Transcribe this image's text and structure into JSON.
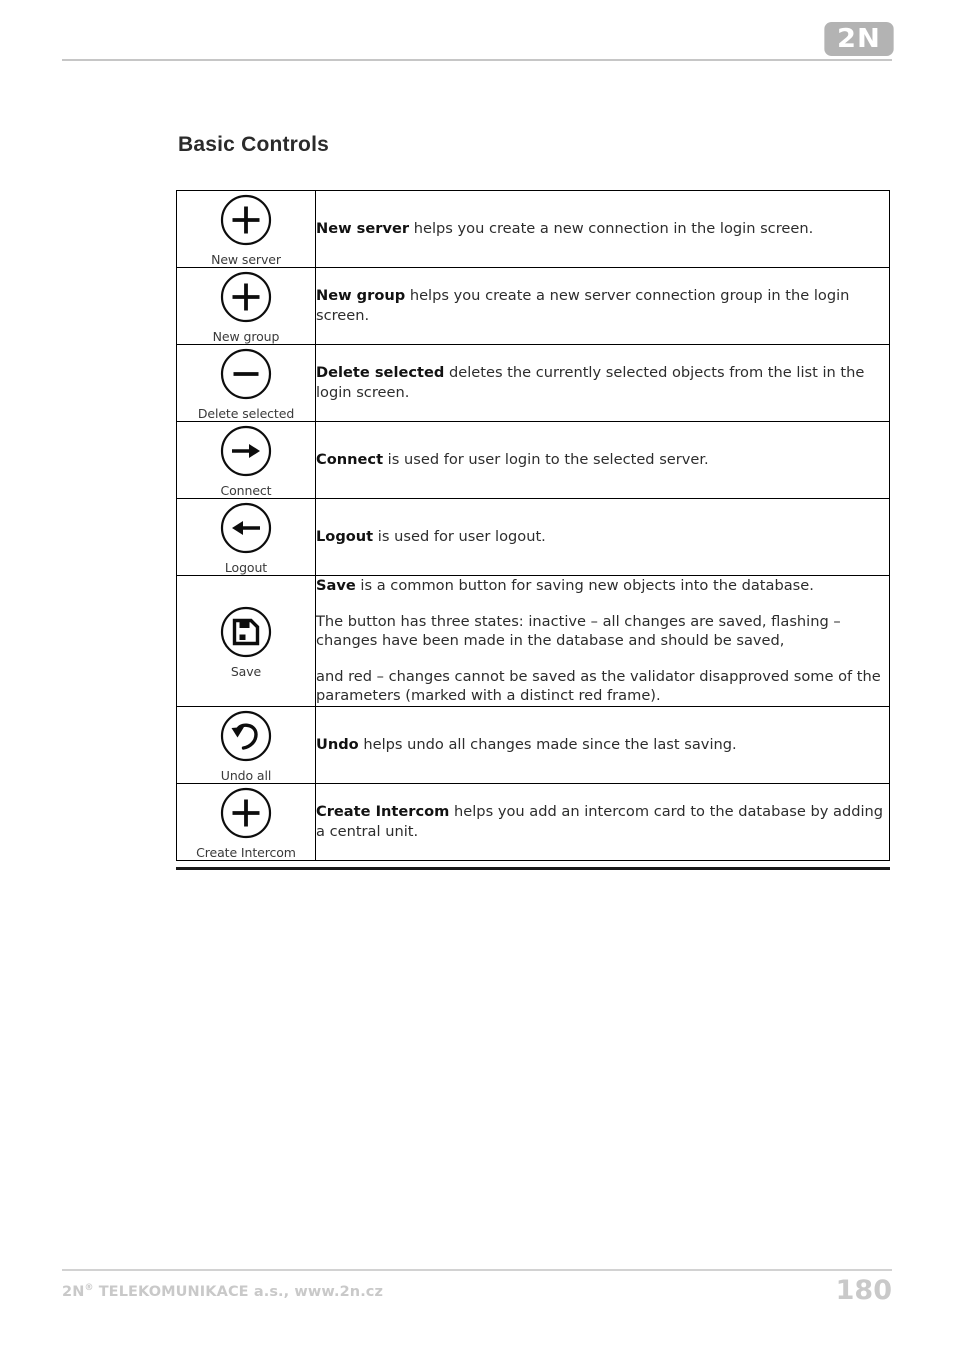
{
  "header": {
    "logo_text": "2N"
  },
  "section": {
    "title": "Basic Controls"
  },
  "table": {
    "rows": [
      {
        "icon": "plus-circle-icon",
        "icon_label": "New server",
        "paragraphs": [
          {
            "bold": "New server",
            "rest": " helps you create a new connection in the login screen."
          }
        ]
      },
      {
        "icon": "plus-circle-icon",
        "icon_label": "New group",
        "paragraphs": [
          {
            "bold": "New group",
            "rest": " helps you create a new server connection group in the login screen."
          }
        ]
      },
      {
        "icon": "minus-circle-icon",
        "icon_label": "Delete selected",
        "paragraphs": [
          {
            "bold": "Delete selected",
            "rest": " deletes the currently selected objects from the list in the login screen."
          }
        ]
      },
      {
        "icon": "arrow-right-circle-icon",
        "icon_label": "Connect",
        "paragraphs": [
          {
            "bold": "Connect",
            "rest": " is used for user login to the selected server."
          }
        ]
      },
      {
        "icon": "arrow-left-circle-icon",
        "icon_label": "Logout",
        "paragraphs": [
          {
            "bold": "Logout",
            "rest": " is used for user logout."
          }
        ]
      },
      {
        "icon": "save-disk-circle-icon",
        "icon_label": "Save",
        "paragraphs": [
          {
            "bold": "Save",
            "rest": " is a common button for saving new objects into the database."
          },
          {
            "bold": "",
            "rest": "The button has three states: inactive – all changes are saved, flashing – changes have been made in the database and should be saved,"
          },
          {
            "bold": "",
            "rest": "and red – changes cannot be saved as the validator disapproved some of the parameters (marked with a distinct red frame)."
          }
        ]
      },
      {
        "icon": "undo-arrow-circle-icon",
        "icon_label": "Undo all",
        "paragraphs": [
          {
            "bold": "Undo",
            "rest": " helps undo all changes made since the last saving."
          }
        ]
      },
      {
        "icon": "plus-circle-icon",
        "icon_label": "Create Intercom",
        "paragraphs": [
          {
            "bold": "Create Intercom",
            "rest": " helps you add an intercom card to the database by adding a central unit."
          }
        ]
      }
    ]
  },
  "footer": {
    "company": "2N",
    "company_sup": "®",
    "company_rest": " TELEKOMUNIKACE a.s., www.2n.cz",
    "page_number": "180"
  }
}
